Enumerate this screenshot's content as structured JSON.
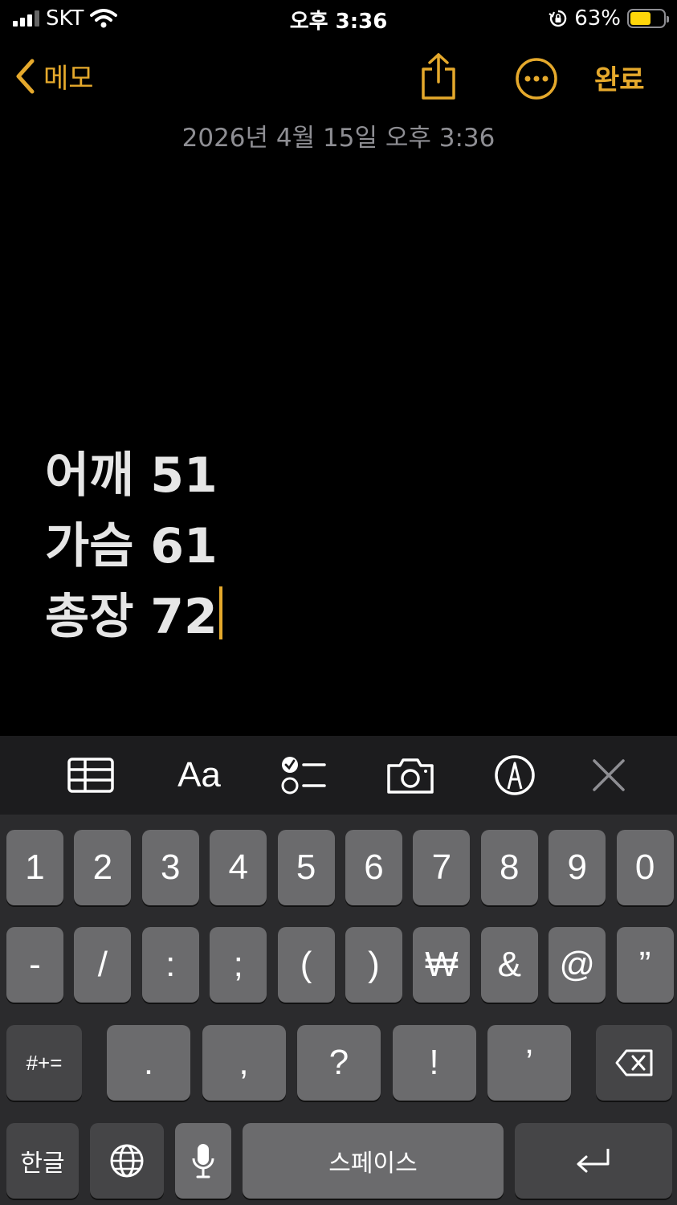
{
  "status_bar": {
    "carrier": "SKT",
    "time": "오후 3:36",
    "battery_percent": "63%",
    "battery_level": 0.63,
    "icons": [
      "signal-icon",
      "wifi-icon",
      "orientation-lock-icon",
      "battery-icon"
    ]
  },
  "nav": {
    "back_label": "메모",
    "done_label": "완료",
    "icons": [
      "chevron-left-icon",
      "share-icon",
      "more-icon"
    ]
  },
  "note": {
    "date": "2026년 4월 15일 오후 3:36",
    "lines": [
      "어깨 51",
      "가슴 61",
      "총장 72"
    ]
  },
  "toolbar": {
    "aa_label": "Aa",
    "icons": [
      "table-icon",
      "format-icon",
      "checklist-icon",
      "camera-icon",
      "markup-icon",
      "close-icon"
    ]
  },
  "keyboard": {
    "row1": [
      "1",
      "2",
      "3",
      "4",
      "5",
      "6",
      "7",
      "8",
      "9",
      "0"
    ],
    "row2": [
      "-",
      "/",
      ":",
      ";",
      "(",
      ")",
      "₩",
      "&",
      "@",
      "”"
    ],
    "row3_left": "#+=",
    "row3": [
      ".",
      ",",
      "?",
      "!",
      "’"
    ],
    "lang_label": "한글",
    "space_label": "스페이스",
    "accent": "#e5a92c"
  }
}
